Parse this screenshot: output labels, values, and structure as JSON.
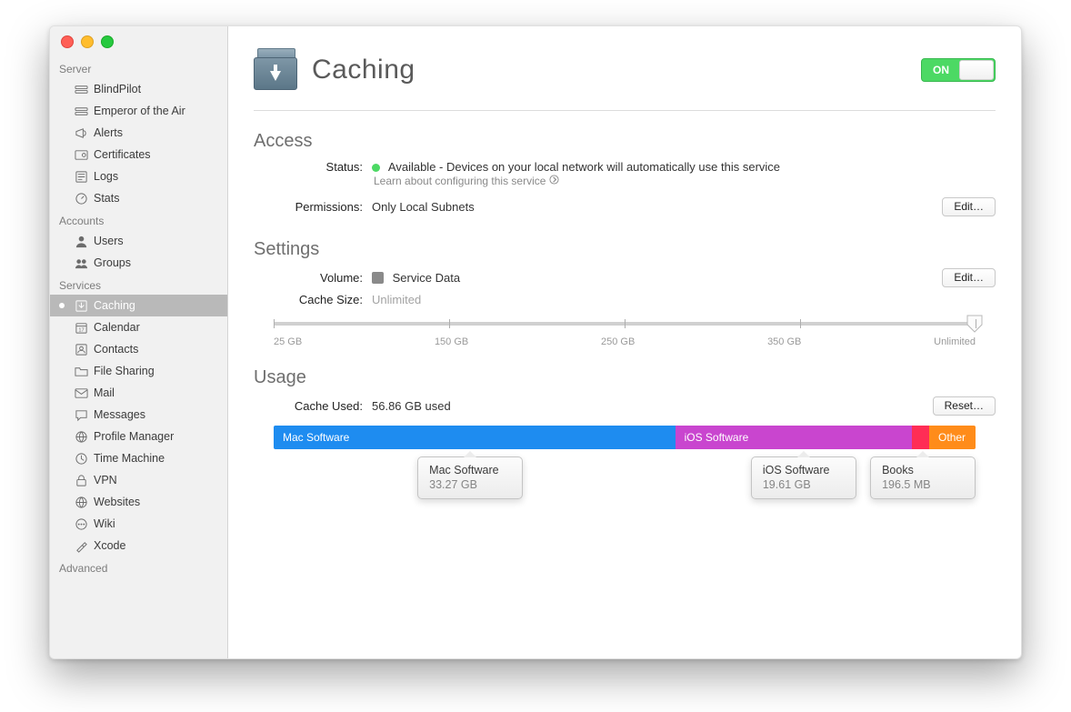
{
  "sidebar": {
    "groups": [
      {
        "label": "Server",
        "items": [
          {
            "label": "BlindPilot",
            "icon": "server"
          },
          {
            "label": "Emperor of the Air",
            "icon": "server"
          },
          {
            "label": "Alerts",
            "icon": "megaphone"
          },
          {
            "label": "Certificates",
            "icon": "certificate"
          },
          {
            "label": "Logs",
            "icon": "log"
          },
          {
            "label": "Stats",
            "icon": "gauge"
          }
        ]
      },
      {
        "label": "Accounts",
        "items": [
          {
            "label": "Users",
            "icon": "user"
          },
          {
            "label": "Groups",
            "icon": "group"
          }
        ]
      },
      {
        "label": "Services",
        "items": [
          {
            "label": "Caching",
            "icon": "download",
            "selected": true,
            "dot": true
          },
          {
            "label": "Calendar",
            "icon": "calendar"
          },
          {
            "label": "Contacts",
            "icon": "contacts"
          },
          {
            "label": "File Sharing",
            "icon": "folder"
          },
          {
            "label": "Mail",
            "icon": "mail"
          },
          {
            "label": "Messages",
            "icon": "messages"
          },
          {
            "label": "Profile Manager",
            "icon": "globe"
          },
          {
            "label": "Time Machine",
            "icon": "clock"
          },
          {
            "label": "VPN",
            "icon": "lock"
          },
          {
            "label": "Websites",
            "icon": "globe"
          },
          {
            "label": "Wiki",
            "icon": "dots"
          },
          {
            "label": "Xcode",
            "icon": "hammer"
          }
        ]
      },
      {
        "label": "Advanced",
        "items": []
      }
    ]
  },
  "header": {
    "title": "Caching",
    "toggle_label": "ON",
    "toggle_on": true
  },
  "access": {
    "section": "Access",
    "status_label": "Status:",
    "status_value": "Available - Devices on your local network will automatically use this service",
    "learn": "Learn about configuring this service",
    "perm_label": "Permissions:",
    "perm_value": "Only Local Subnets",
    "edit": "Edit…"
  },
  "settings": {
    "section": "Settings",
    "volume_label": "Volume:",
    "volume_value": "Service Data",
    "cache_size_label": "Cache Size:",
    "cache_size_value": "Unlimited",
    "edit": "Edit…",
    "slider_ticks": [
      "25 GB",
      "150 GB",
      "250 GB",
      "350 GB",
      "Unlimited"
    ]
  },
  "usage": {
    "section": "Usage",
    "used_label": "Cache Used:",
    "used_value": "56.86 GB used",
    "reset": "Reset…",
    "segments": [
      {
        "label": "Mac Software",
        "color": "#1e8cf0",
        "pct": 57.2
      },
      {
        "label": "iOS Software",
        "color": "#c945cf",
        "pct": 33.7
      },
      {
        "label": "",
        "color": "#ff2d55",
        "pct": 2.5
      },
      {
        "label": "Other",
        "color": "#ff8c1a",
        "pct": 6.6
      }
    ],
    "callouts": [
      {
        "title": "Mac Software",
        "value": "33.27 GB",
        "left_pct": 28
      },
      {
        "title": "iOS Software",
        "value": "19.61 GB",
        "left_pct": 75.5
      },
      {
        "title": "Books",
        "value": "196.5 MB",
        "left_pct": 92.5
      }
    ]
  }
}
